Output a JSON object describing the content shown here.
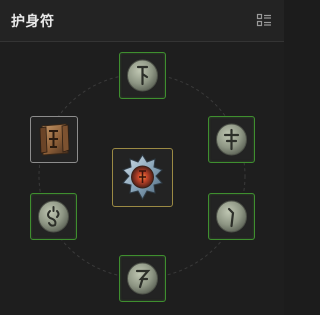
{
  "panel": {
    "title": "护身符",
    "list_icon": "list-view-icon"
  },
  "slots": {
    "top": {
      "icon": "rune-stone-icon",
      "state": "equipped"
    },
    "upper_right": {
      "icon": "rune-stone-icon",
      "state": "equipped"
    },
    "lower_right": {
      "icon": "rune-stone-icon",
      "state": "equipped"
    },
    "bottom": {
      "icon": "rune-stone-icon",
      "state": "equipped"
    },
    "lower_left": {
      "icon": "rune-stone-icon",
      "state": "equipped"
    },
    "upper_left": {
      "icon": "rune-tablet-icon",
      "state": "selected"
    },
    "center": {
      "icon": "amulet-core-icon",
      "state": "core"
    }
  },
  "colors": {
    "background": "#1e1e1e",
    "header": "#232323",
    "slot_border_green": "#3f8f2f",
    "slot_border_gray": "#8d8d8d",
    "slot_border_gold": "#9b8a44"
  }
}
